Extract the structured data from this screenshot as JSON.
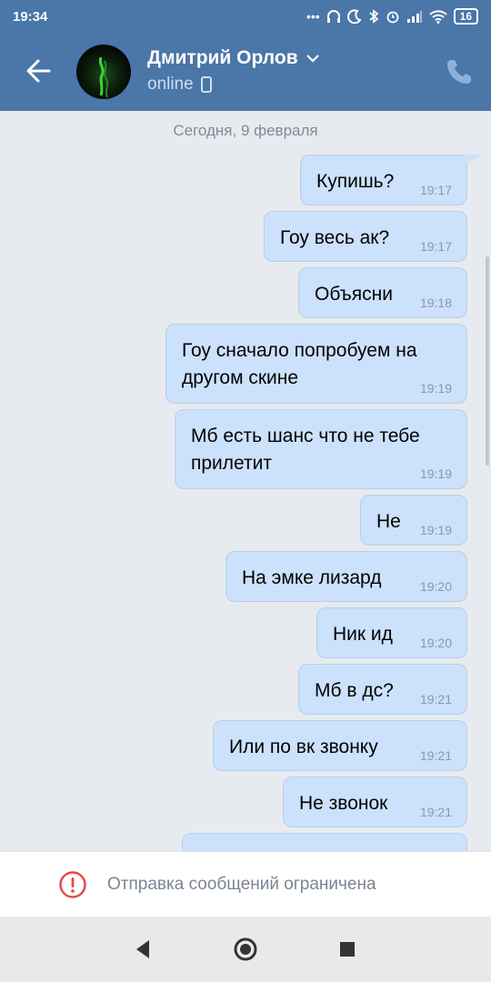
{
  "status_bar": {
    "time": "19:34",
    "icons": [
      "dots-icon",
      "headphones-icon",
      "moon-icon",
      "bluetooth-icon",
      "alarm-icon",
      "signal-icon",
      "wifi-icon"
    ],
    "battery": "16"
  },
  "header": {
    "name": "Дмитрий Орлов",
    "status": "online",
    "accent": "#4a76a8"
  },
  "chat": {
    "date": "Сегодня, 9 февраля",
    "messages": [
      {
        "text": "Купишь?",
        "time": "19:17"
      },
      {
        "text": "Гоу весь ак?",
        "time": "19:17"
      },
      {
        "text": "Объясни",
        "time": "19:18"
      },
      {
        "text": "Гоу сначало попробуем на другом скине",
        "time": "19:19"
      },
      {
        "text": "Мб есть шанс что не тебе прилетит",
        "time": "19:19"
      },
      {
        "text": "Не",
        "time": "19:19"
      },
      {
        "text": "На эмке лизард",
        "time": "19:20"
      },
      {
        "text": "Ник ид",
        "time": "19:20"
      },
      {
        "text": "Мб в дс?",
        "time": "19:21"
      },
      {
        "text": "Или по вк звонку",
        "time": "19:21"
      },
      {
        "text": "Не звонок",
        "time": "19:21"
      }
    ]
  },
  "footer": {
    "text": "Отправка сообщений ограничена",
    "warn_color": "#e64646"
  }
}
